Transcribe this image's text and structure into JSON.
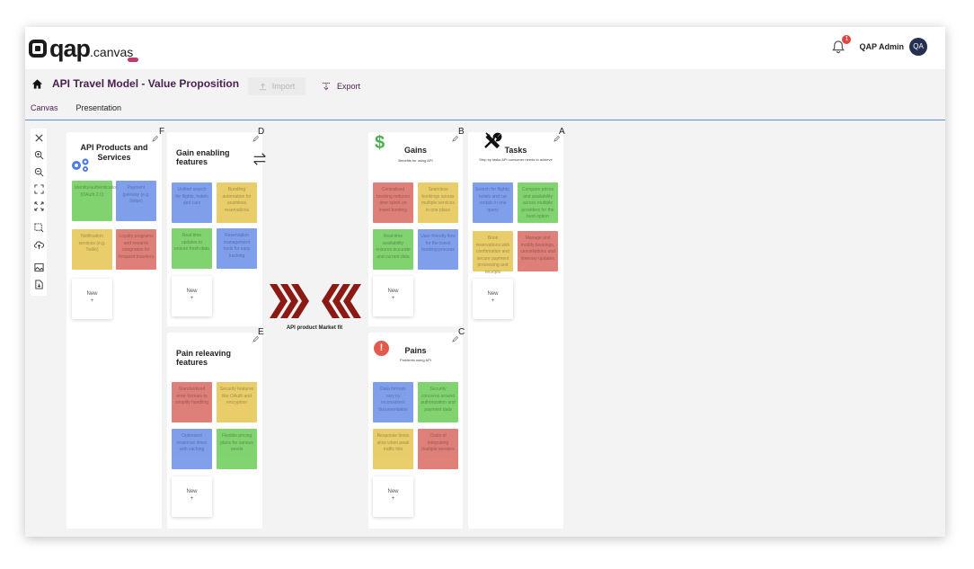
{
  "app": {
    "logo_main": "qap",
    "logo_sub": ".canvas",
    "notification_count": "1",
    "user_name": "QAP Admin",
    "user_initials": "QA"
  },
  "page": {
    "title": "API Travel Model - Value Proposition",
    "import_label": "Import",
    "export_label": "Export"
  },
  "tabs": [
    {
      "label": "Canvas",
      "active": true
    },
    {
      "label": "Presentation",
      "active": false
    }
  ],
  "toolbar": {
    "icons": [
      "close-icon",
      "zoom-in-icon",
      "zoom-out-icon",
      "fit-screen-icon",
      "fullscreen-icon",
      "select-area-icon",
      "cloud-upload-icon",
      "image-export-icon",
      "document-export-icon"
    ]
  },
  "panels": {
    "F": {
      "letter": "F",
      "title": "API Products and Services",
      "subtitle": "",
      "icon": "gears-icon",
      "notes": [
        {
          "text": "Identity/authentication (OAuth 2.0)",
          "color": "green"
        },
        {
          "text": "Payment gateway (e.g. Stripe)",
          "color": "blue"
        },
        {
          "text": "Notification services (e.g. Twilio)",
          "color": "yellow"
        },
        {
          "text": "Loyalty programs and rewards integration for frequent travelers",
          "color": "red"
        }
      ],
      "new_label": "New",
      "plus": "+"
    },
    "D": {
      "letter": "D",
      "title": "Gain enabling features",
      "subtitle": "",
      "icon": "swap-arrows-icon",
      "notes": [
        {
          "text": "Unified search for flights, hotels and cars",
          "color": "blue"
        },
        {
          "text": "Bundling automation for seamless reservations",
          "color": "yellow"
        },
        {
          "text": "Real-time updates to ensure fresh data",
          "color": "green"
        },
        {
          "text": "Reservation management tools for easy tracking",
          "color": "blue"
        }
      ],
      "new_label": "New",
      "plus": "+"
    },
    "E": {
      "letter": "E",
      "title": "Pain releaving features",
      "subtitle": "",
      "notes": [
        {
          "text": "Standardized error formats to simplify handling",
          "color": "red"
        },
        {
          "text": "Security features like OAuth and encryption",
          "color": "yellow"
        },
        {
          "text": "Optimized response times with caching",
          "color": "blue"
        },
        {
          "text": "Flexible pricing plans for various needs",
          "color": "green"
        }
      ],
      "new_label": "New",
      "plus": "+"
    },
    "B": {
      "letter": "B",
      "title": "Gains",
      "subtitle": "Benefits for using API",
      "icon": "dollar-icon",
      "notes": [
        {
          "text": "Centralized booking reduces time spent on travel booking",
          "color": "red"
        },
        {
          "text": "Seamless bookings across multiple services in one place",
          "color": "yellow"
        },
        {
          "text": "Real-time availability ensures accurate and current data",
          "color": "green"
        },
        {
          "text": "User-friendly flow for the travel booking process",
          "color": "blue"
        }
      ],
      "new_label": "New",
      "plus": "+"
    },
    "C": {
      "letter": "C",
      "title": "Pains",
      "subtitle": "Problems using API",
      "icon": "alert-icon",
      "notes": [
        {
          "text": "Data formats vary by inconsistent documentation",
          "color": "blue"
        },
        {
          "text": "Security concerns around authorization and payment data",
          "color": "green"
        },
        {
          "text": "Response times slow when peak traffic hits",
          "color": "yellow"
        },
        {
          "text": "Costs of integrating multiple vendors",
          "color": "red"
        }
      ],
      "new_label": "New",
      "plus": "+"
    },
    "A": {
      "letter": "A",
      "title": "Tasks",
      "subtitle": "Step by tasks API consumer needs to achieve",
      "icon": "tools-icon",
      "notes": [
        {
          "text": "Search for flights, hotels and car rentals in one query",
          "color": "blue"
        },
        {
          "text": "Compare prices and availability across multiple providers for the best option",
          "color": "green"
        },
        {
          "text": "Book reservations with confirmation and secure payment processing and receipts",
          "color": "yellow"
        },
        {
          "text": "Manage and modify bookings, cancellations and itinerary updates",
          "color": "red"
        }
      ],
      "new_label": "New",
      "plus": "+"
    }
  },
  "center": {
    "label": "API product Market fit"
  },
  "colors": {
    "accent": "#4a1d4f",
    "fit_arrows": "#8b1a14",
    "green": "#6ccc57",
    "blue": "#6b8fe8",
    "yellow": "#e6c551",
    "red": "#d96a62"
  }
}
